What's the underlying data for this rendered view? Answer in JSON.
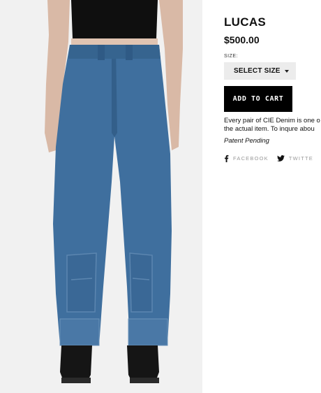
{
  "product": {
    "title": "LUCAS",
    "price": "$500.00",
    "size_label": "SIZE:",
    "size_select": "SELECT SIZE",
    "add_to_cart": "ADD TO CART",
    "description_line1": "Every pair of CIE Denim is one o",
    "description_line2": "the actual item.  To inqure abou",
    "patent": "Patent Pending"
  },
  "share": {
    "facebook": "FACEBOOK",
    "twitter": "TWITTE"
  },
  "icons": {
    "size_dropdown": "chevron-down-icon",
    "facebook": "facebook-icon",
    "twitter": "twitter-icon"
  },
  "colors": {
    "denim": "#3f6f9e",
    "button": "#000000",
    "select_bg": "#ececec",
    "share_text": "#999999"
  }
}
